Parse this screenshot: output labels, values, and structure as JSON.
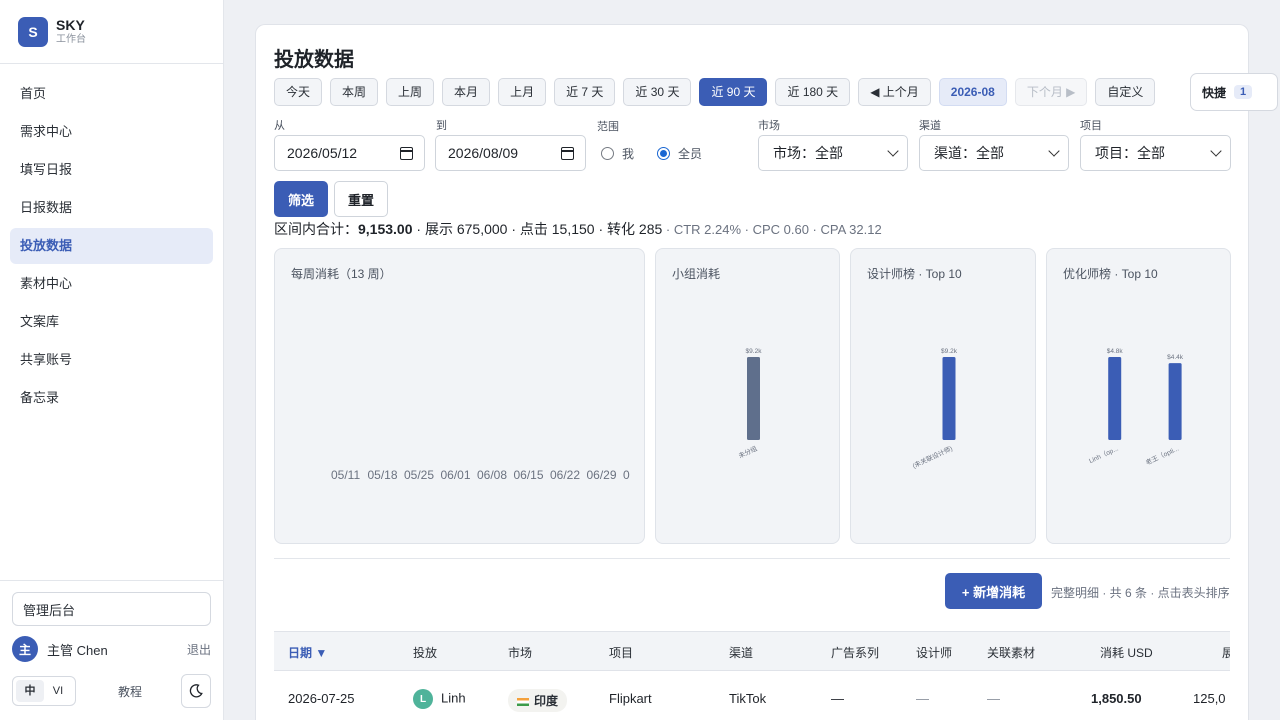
{
  "brand": {
    "logo_letter": "S",
    "name": "SKY",
    "subtitle": "工作台"
  },
  "sidebar": {
    "items": [
      {
        "label": "首页"
      },
      {
        "label": "需求中心"
      },
      {
        "label": "填写日报"
      },
      {
        "label": "日报数据"
      },
      {
        "label": "投放数据",
        "active": true
      },
      {
        "label": "素材中心"
      },
      {
        "label": "文案库"
      },
      {
        "label": "共享账号"
      },
      {
        "label": "备忘录"
      }
    ],
    "admin_label": "管理后台",
    "user": {
      "avatar": "主",
      "name": "主管 Chen",
      "logout": "退出"
    },
    "lang": {
      "zh": "中",
      "vi": "VI"
    },
    "tutorial": "教程",
    "theme_icon": "moon-icon"
  },
  "page": {
    "title": "投放数据",
    "ranges": [
      "今天",
      "本周",
      "上周",
      "本月",
      "上月",
      "近 7 天",
      "近 30 天",
      "近 90 天",
      "近 180 天",
      "◀ 上个月",
      "2026-08",
      "下个月 ▶",
      "自定义"
    ],
    "active_range": "近 90 天",
    "quick": {
      "label": "快捷",
      "count": "1"
    },
    "filters": {
      "from_label": "从",
      "from_value": "2026/05/12",
      "to_label": "到",
      "to_value": "2026/08/09",
      "scope_label": "范围",
      "scope_me": "我",
      "scope_all": "全员",
      "market_label": "市场",
      "market_value": "市场：全部",
      "channel_label": "渠道",
      "channel_value": "渠道：全部",
      "project_label": "项目",
      "project_value": "项目：全部"
    },
    "filter_btn": "筛选",
    "reset_btn": "重置",
    "summary": {
      "prefix": "区间内合计：",
      "spend": "9,153.00",
      "rest": " · 展示 675,000 · 点击 15,150 · 转化 285",
      "muted": " · CTR 2.24% · CPC 0.60 · CPA 32.12"
    },
    "add_btn": "+ 新增消耗",
    "detail_note": "完整明细 · 共 6 条 · 点击表头排序"
  },
  "chart_data": [
    {
      "type": "bar",
      "title": "每周消耗（13 周）",
      "categories": [
        "05/11",
        "05/18",
        "05/25",
        "06/01",
        "06/08",
        "06/15",
        "06/22",
        "06/29",
        "0"
      ],
      "values": []
    },
    {
      "type": "bar",
      "title": "小组消耗",
      "categories": [
        "未分组"
      ],
      "values": [
        9153
      ],
      "value_labels": [
        "$9.2k"
      ],
      "color": "#5f6f8c"
    },
    {
      "type": "bar",
      "title": "设计师榜 · Top 10",
      "categories": [
        "(未关联设计师)"
      ],
      "values": [
        9153
      ],
      "value_labels": [
        "$9.2k"
      ],
      "color": "#3b5db5"
    },
    {
      "type": "bar",
      "title": "优化师榜 · Top 10",
      "categories": [
        "Linh（op...",
        "老王（opti..."
      ],
      "values": [
        4750,
        4400
      ],
      "value_labels": [
        "$4.8k",
        "$4.4k"
      ],
      "color": "#3b5db5"
    }
  ],
  "table": {
    "headers": [
      "日期 ▼",
      "投放",
      "市场",
      "项目",
      "渠道",
      "广告系列",
      "设计师",
      "关联素材",
      "消耗 USD",
      "展"
    ],
    "rows": [
      {
        "date": "2026-07-25",
        "owner_initial": "L",
        "owner": "Linh",
        "market": "印度",
        "project": "Flipkart",
        "channel": "TikTok",
        "campaign": "—",
        "designer": "—",
        "material": "—",
        "spend": "1,850.50",
        "impressions": "125,0"
      }
    ]
  }
}
